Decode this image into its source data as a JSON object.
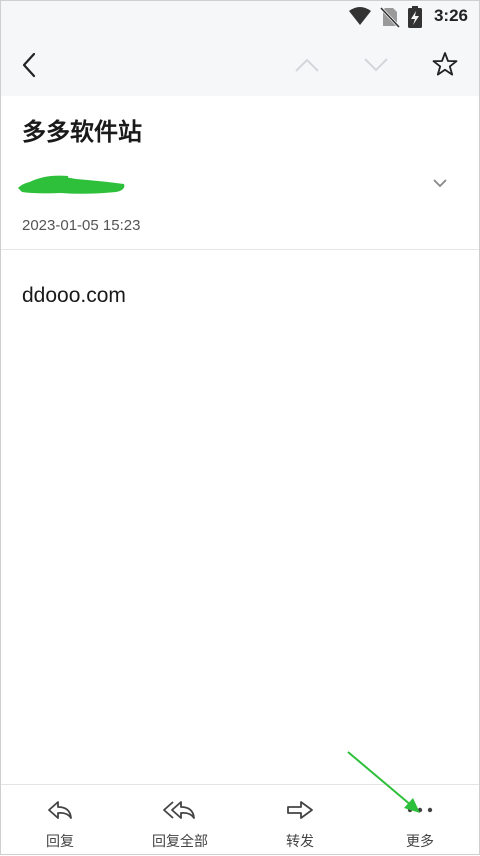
{
  "status_bar": {
    "time": "3:26",
    "icons": [
      "wifi-icon",
      "no-sim-icon",
      "battery-charging-icon"
    ]
  },
  "app_bar": {
    "icons": [
      "back-arrow-icon",
      "previous-mail-icon",
      "next-mail-icon",
      "star-icon"
    ]
  },
  "mail": {
    "subject": "多多软件站",
    "date": "2023-01-05 15:23",
    "body": "ddooo.com"
  },
  "bottom_bar": {
    "items": [
      {
        "label": "回复",
        "icon": "reply-icon"
      },
      {
        "label": "回复全部",
        "icon": "reply-all-icon"
      },
      {
        "label": "转发",
        "icon": "forward-icon"
      },
      {
        "label": "更多",
        "icon": "more-icon"
      }
    ]
  },
  "colors": {
    "annotation": "#2ec03a",
    "bar_bg": "#f6f7f9"
  }
}
